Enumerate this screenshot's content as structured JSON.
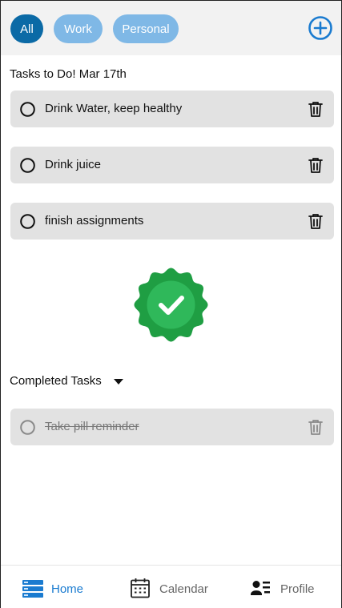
{
  "filters": {
    "all_label": "All",
    "work_label": "Work",
    "personal_label": "Personal"
  },
  "tasks_header": "Tasks to Do! Mar 17th",
  "tasks": [
    {
      "label": "Drink Water, keep healthy"
    },
    {
      "label": "Drink juice"
    },
    {
      "label": "finish assignments"
    }
  ],
  "completed": {
    "header": "Completed Tasks",
    "items": [
      {
        "label": "Take pill reminder"
      }
    ]
  },
  "nav": {
    "home_label": "Home",
    "calendar_label": "Calendar",
    "profile_label": "Profile"
  },
  "colors": {
    "chip_active": "#0b6aa6",
    "chip_inactive": "#7fb8e6",
    "accent": "#1a7bd0",
    "badge_green": "#1f9e43",
    "task_bg": "#e2e2e2"
  },
  "icons": {
    "add": "plus-circle-icon",
    "task_status": "circle-icon",
    "delete": "trash-icon",
    "badge": "checkmark-badge-icon",
    "home": "list-icon",
    "calendar": "calendar-icon",
    "profile": "contact-card-icon"
  }
}
